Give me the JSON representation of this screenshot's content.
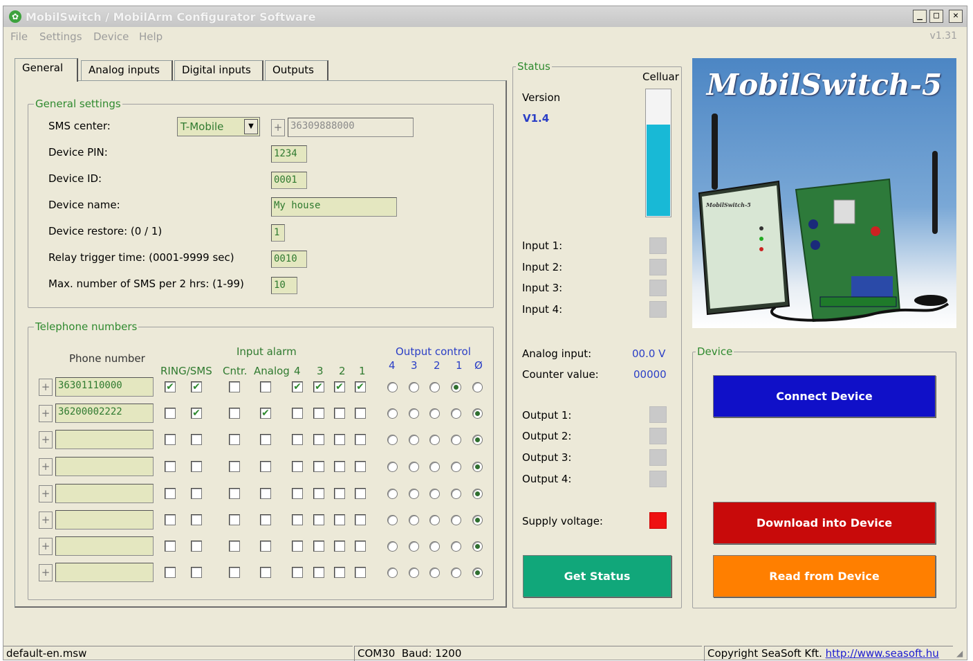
{
  "window": {
    "title": "MobilSwitch / MobilArm Configurator Software",
    "version": "v1.31"
  },
  "menu": [
    "File",
    "Settings",
    "Device",
    "Help"
  ],
  "tabs": [
    "General",
    "Analog inputs",
    "Digital inputs",
    "Outputs"
  ],
  "general_settings": {
    "legend": "General settings",
    "sms_center_label": "SMS center:",
    "sms_center_value": "T-Mobile",
    "sms_center_number": "36309888000",
    "pin_label": "Device PIN:",
    "pin_value": "1234",
    "id_label": "Device ID:",
    "id_value": "0001",
    "name_label": "Device name:",
    "name_value": "My house",
    "restore_label": "Device restore: (0 / 1)",
    "restore_value": "1",
    "relay_label": "Relay trigger time: (0001-9999 sec)",
    "relay_value": "0010",
    "maxsms_label": "Max. number of SMS per 2 hrs: (1-99)",
    "maxsms_value": "10"
  },
  "telephone": {
    "legend": "Telephone numbers",
    "phone_header": "Phone number",
    "input_alarm_header": "Input alarm",
    "output_control_header": "Output control",
    "col_ring_sms": "RING/SMS",
    "col_cntr": "Cntr.",
    "col_analog": "Analog",
    "input_cols": [
      "4",
      "3",
      "2",
      "1"
    ],
    "output_cols": [
      "4",
      "3",
      "2",
      "1",
      "Ø"
    ],
    "rows": [
      {
        "number": "36301110000",
        "ring": true,
        "sms": true,
        "cntr": false,
        "analog": false,
        "inputs": [
          true,
          true,
          true,
          true
        ],
        "output_selected": 3
      },
      {
        "number": "36200002222",
        "ring": false,
        "sms": true,
        "cntr": false,
        "analog": true,
        "inputs": [
          false,
          false,
          false,
          false
        ],
        "output_selected": 4
      },
      {
        "number": "",
        "ring": false,
        "sms": false,
        "cntr": false,
        "analog": false,
        "inputs": [
          false,
          false,
          false,
          false
        ],
        "output_selected": 4
      },
      {
        "number": "",
        "ring": false,
        "sms": false,
        "cntr": false,
        "analog": false,
        "inputs": [
          false,
          false,
          false,
          false
        ],
        "output_selected": 4
      },
      {
        "number": "",
        "ring": false,
        "sms": false,
        "cntr": false,
        "analog": false,
        "inputs": [
          false,
          false,
          false,
          false
        ],
        "output_selected": 4
      },
      {
        "number": "",
        "ring": false,
        "sms": false,
        "cntr": false,
        "analog": false,
        "inputs": [
          false,
          false,
          false,
          false
        ],
        "output_selected": 4
      },
      {
        "number": "",
        "ring": false,
        "sms": false,
        "cntr": false,
        "analog": false,
        "inputs": [
          false,
          false,
          false,
          false
        ],
        "output_selected": 4
      },
      {
        "number": "",
        "ring": false,
        "sms": false,
        "cntr": false,
        "analog": false,
        "inputs": [
          false,
          false,
          false,
          false
        ],
        "output_selected": 4
      }
    ]
  },
  "status": {
    "legend": "Status",
    "cellular_label": "Celluar",
    "cellular_level": 0.72,
    "version_label": "Version",
    "version_value": "V1.4",
    "inputs": [
      "Input 1:",
      "Input 2:",
      "Input 3:",
      "Input 4:"
    ],
    "analog_label": "Analog input:",
    "analog_value": "00.0 V",
    "counter_label": "Counter value:",
    "counter_value": "00000",
    "outputs": [
      "Output 1:",
      "Output 2:",
      "Output 3:",
      "Output 4:"
    ],
    "supply_label": "Supply voltage:",
    "get_status_label": "Get Status",
    "colors": {
      "indicator_off": "#c9c9c9",
      "supply": "#ee1111",
      "cellular": "#18b9d6",
      "get_status": "#11a77a"
    }
  },
  "product": {
    "title": "MobilSwitch-5",
    "device_label": "MobilSwitch-5"
  },
  "device": {
    "legend": "Device",
    "connect_label": "Connect Device",
    "download_label": "Download into Device",
    "read_label": "Read from Device",
    "colors": {
      "connect": "#1010c8",
      "download": "#c80a0a",
      "read": "#ff7f00"
    }
  },
  "statusbar": {
    "file": "default-en.msw",
    "port": "COM30",
    "baud": "Baud: 1200",
    "copyright": "Copyright SeaSoft Kft.",
    "url": "http://www.seasoft.hu"
  }
}
